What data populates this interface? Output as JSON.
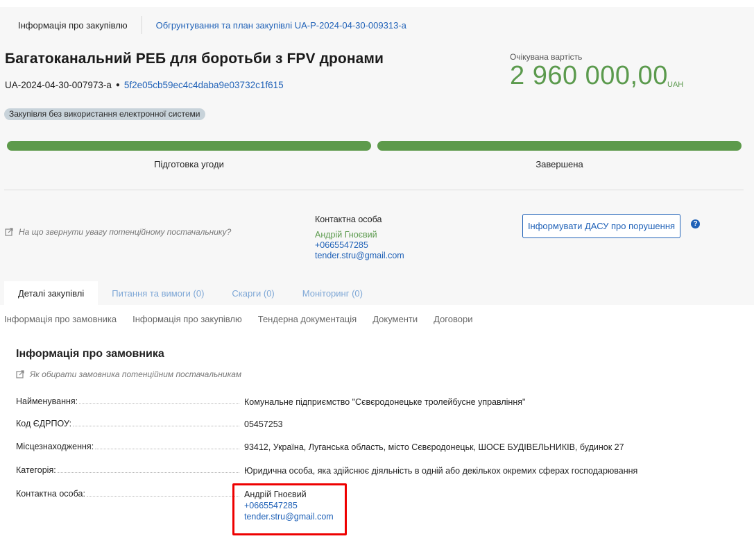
{
  "top_tabs": {
    "active": "Інформація про закупівлю",
    "link": "Обгрунтування та план закупівлі UA-P-2024-04-30-009313-a"
  },
  "tender": {
    "title": "Багатоканальний РЕБ для боротьби з FPV дронами",
    "id": "UA-2024-04-30-007973-a",
    "hash": "5f2e05cb59ec4c4daba9e03732c1f615",
    "badge": "Закупівля без використання електронної системи"
  },
  "value": {
    "label": "Очікувана вартість",
    "amount": "2 960 000,00",
    "currency": "UAH"
  },
  "progress": {
    "stages": [
      {
        "label": "Підготовка угоди",
        "fill": 1.0
      },
      {
        "label": "Завершена",
        "fill": 1.0
      }
    ],
    "color": "#5d9a4b"
  },
  "hint": "На що звернути увагу потенційному постачальнику?",
  "contact": {
    "label": "Контактна особа",
    "name": "Андрій Гноєвий",
    "phone": "+0665547285",
    "email": "tender.stru@gmail.com"
  },
  "dasu_button": "Інформувати ДАСУ про порушення",
  "help_icon": "question-icon",
  "main_tabs": [
    {
      "label": "Деталі закупівлі",
      "active": true
    },
    {
      "label": "Питання та вимоги (0)",
      "active": false
    },
    {
      "label": "Скарги (0)",
      "active": false
    },
    {
      "label": "Моніторинг (0)",
      "active": false
    }
  ],
  "subnav": [
    "Інформація про замовника",
    "Інформація про закупівлю",
    "Тендерна документація",
    "Документи",
    "Договори"
  ],
  "customer": {
    "section_title": "Інформація про замовника",
    "hint": "Як обирати замовника потенційним постачальникам",
    "rows": [
      {
        "key": "Найменування:",
        "value": "Комунальне підприємство \"Сєвєродонецьке тролейбусне управління\""
      },
      {
        "key": "Код ЄДРПОУ:",
        "value": "05457253"
      },
      {
        "key": "Місцезнаходження:",
        "value": "93412, Україна, Луганська область, місто Сєвєродонецьк, ШОСЕ БУДІВЕЛЬНИКІВ, будинок 27"
      },
      {
        "key": "Категорія:",
        "value": "Юридична особа, яка здійснює діяльність в одній або декількох окремих сферах господарювання"
      },
      {
        "key": "Контактна особа:",
        "name": "Андрій Гноєвий",
        "phone": "+0665547285",
        "email": "tender.stru@gmail.com"
      }
    ]
  },
  "colors": {
    "accent": "#1f61b7",
    "green": "#5b9a4d",
    "highlight": "#ee0000"
  }
}
